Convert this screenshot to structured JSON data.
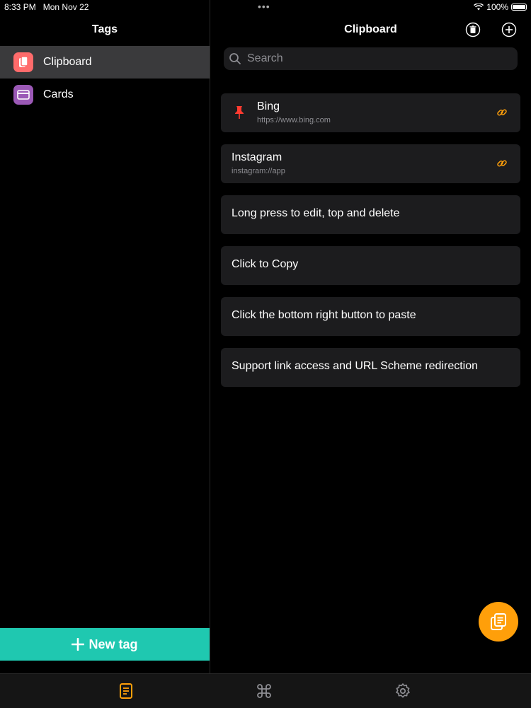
{
  "status": {
    "time": "8:33 PM",
    "date": "Mon Nov 22",
    "battery": "100%"
  },
  "sidebar": {
    "title": "Tags",
    "items": [
      {
        "label": "Clipboard",
        "icon": "clipboard-icon",
        "color": "#ff6b6b",
        "selected": true
      },
      {
        "label": "Cards",
        "icon": "card-icon",
        "color": "#9b59b6",
        "selected": false
      }
    ],
    "new_tag_label": "New tag"
  },
  "main": {
    "title": "Clipboard",
    "search_placeholder": "Search",
    "items": [
      {
        "title": "Bing",
        "subtitle": "https://www.bing.com",
        "pinned": true,
        "link": true
      },
      {
        "title": "Instagram",
        "subtitle": "instagram://app",
        "pinned": false,
        "link": true
      },
      {
        "title": "Long press to edit, top and delete"
      },
      {
        "title": "Click to Copy"
      },
      {
        "title": "Click the bottom right button to paste"
      },
      {
        "title": "Support link access and URL Scheme redirection"
      }
    ]
  },
  "tabbar": {
    "tabs": [
      "notes-icon",
      "command-icon",
      "gear-icon"
    ],
    "active_color": "#ff9f0a"
  },
  "colors": {
    "accent": "#ff9f0a",
    "new_tag": "#1fc8b0",
    "pin": "#ff3b30"
  }
}
